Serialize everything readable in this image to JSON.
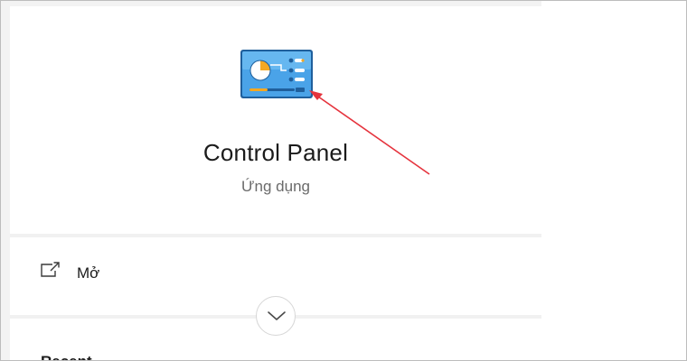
{
  "app": {
    "title": "Control Panel",
    "subtitle": "Ứng dụng",
    "icon": "control-panel-icon"
  },
  "actions": {
    "open_label": "Mở",
    "open_icon": "open-external-icon",
    "expand_icon": "chevron-down-icon"
  },
  "sections": {
    "recent_label": "Recent"
  },
  "colors": {
    "annotation_arrow": "#e5333d",
    "icon_blue": "#4aa3e8",
    "icon_frame": "#1f5f9c",
    "icon_accent": "#f4a823"
  }
}
